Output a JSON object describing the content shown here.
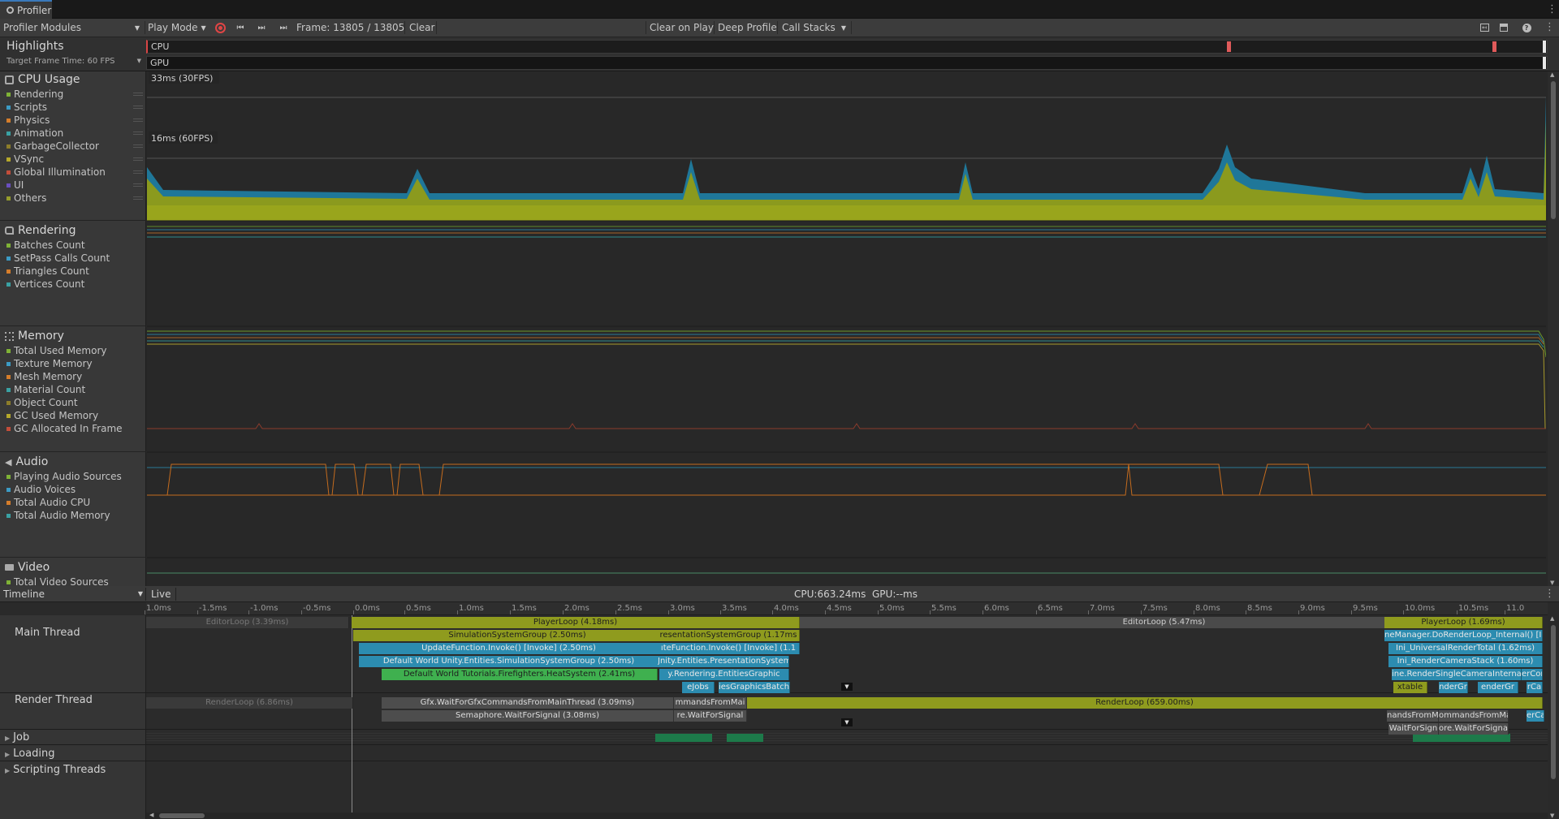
{
  "window": {
    "tab_title": "Profiler"
  },
  "toolbar": {
    "modules_label": "Profiler Modules",
    "play_mode_label": "Play Mode",
    "frame_label": "Frame: 13805 / 13805",
    "clear_label": "Clear",
    "clear_on_play_label": "Clear on Play",
    "deep_profile_label": "Deep Profile",
    "call_stacks_label": "Call Stacks"
  },
  "highlights": {
    "title": "Highlights",
    "target_label": "Target Frame Time: 60 FPS",
    "cpu_label": "CPU",
    "gpu_label": "GPU"
  },
  "modules": [
    {
      "name": "CPU Usage",
      "icon": "cpu-icon",
      "series": [
        {
          "label": "Rendering",
          "color": "#7fb236"
        },
        {
          "label": "Scripts",
          "color": "#3c9bc4"
        },
        {
          "label": "Physics",
          "color": "#d57d2b"
        },
        {
          "label": "Animation",
          "color": "#3aa1a3"
        },
        {
          "label": "GarbageCollector",
          "color": "#8c7d2a"
        },
        {
          "label": "VSync",
          "color": "#b5a82b"
        },
        {
          "label": "Global Illumination",
          "color": "#c24d3a"
        },
        {
          "label": "UI",
          "color": "#6a4fbf"
        },
        {
          "label": "Others",
          "color": "#959c2c"
        }
      ]
    },
    {
      "name": "Rendering",
      "icon": "rendering-icon",
      "series": [
        {
          "label": "Batches Count",
          "color": "#7fb236"
        },
        {
          "label": "SetPass Calls Count",
          "color": "#3c9bc4"
        },
        {
          "label": "Triangles Count",
          "color": "#d57d2b"
        },
        {
          "label": "Vertices Count",
          "color": "#3aa1a3"
        }
      ]
    },
    {
      "name": "Memory",
      "icon": "memory-icon",
      "series": [
        {
          "label": "Total Used Memory",
          "color": "#7fb236"
        },
        {
          "label": "Texture Memory",
          "color": "#3c9bc4"
        },
        {
          "label": "Mesh Memory",
          "color": "#d57d2b"
        },
        {
          "label": "Material Count",
          "color": "#3aa1a3"
        },
        {
          "label": "Object Count",
          "color": "#8c7d2a"
        },
        {
          "label": "GC Used Memory",
          "color": "#b5a82b"
        },
        {
          "label": "GC Allocated In Frame",
          "color": "#c24d3a"
        }
      ]
    },
    {
      "name": "Audio",
      "icon": "audio-icon",
      "series": [
        {
          "label": "Playing Audio Sources",
          "color": "#7fb236"
        },
        {
          "label": "Audio Voices",
          "color": "#3c9bc4"
        },
        {
          "label": "Total Audio CPU",
          "color": "#d57d2b"
        },
        {
          "label": "Total Audio Memory",
          "color": "#3aa1a3"
        }
      ]
    },
    {
      "name": "Video",
      "icon": "video-icon",
      "series": [
        {
          "label": "Total Video Sources",
          "color": "#7fb236"
        }
      ]
    }
  ],
  "cpu_chart": {
    "label_33": "33ms (30FPS)",
    "label_16": "16ms (60FPS)"
  },
  "details": {
    "view_label": "Timeline",
    "live_label": "Live",
    "cpu_gpu_label": "CPU:663.24ms  GPU:--ms",
    "ruler_ticks": [
      "1.0ms",
      "-1.5ms",
      "-1.0ms",
      "-0.5ms",
      "0.0ms",
      "0.5ms",
      "1.0ms",
      "1.5ms",
      "2.0ms",
      "2.5ms",
      "3.0ms",
      "3.5ms",
      "4.0ms",
      "4.5ms",
      "5.0ms",
      "5.5ms",
      "6.0ms",
      "6.5ms",
      "7.0ms",
      "7.5ms",
      "8.0ms",
      "8.5ms",
      "9.0ms",
      "9.5ms",
      "10.0ms",
      "10.5ms",
      "11.0"
    ],
    "threads": [
      "Main Thread",
      "Render Thread"
    ],
    "groups": [
      "Job",
      "Loading",
      "Scripting Threads"
    ],
    "main_bars": [
      {
        "text": "EditorLoop (3.39ms)",
        "color": "#3a3a3a",
        "fg": "#777"
      },
      {
        "text": "PlayerLoop (4.18ms)",
        "color": "#8f9b1e",
        "fg": "#1e1e1e"
      },
      {
        "text": "EditorLoop (5.47ms)",
        "color": "#4a4a4a",
        "fg": "#cfcfcf"
      },
      {
        "text": "PlayerLoop (1.69ms)",
        "color": "#8f9b1e",
        "fg": "#1e1e1e"
      },
      {
        "text": "SimulationSystemGroup (2.50ms)",
        "color": "#8f9b1e",
        "fg": "#1e1e1e"
      },
      {
        "text": "resentationSystemGroup (1.17ms",
        "color": "#8f9b1e",
        "fg": "#1e1e1e"
      },
      {
        "text": "UpdateFunction.Invoke() [Invoke] (2.50ms)",
        "color": "#2c8cb0",
        "fg": "#e8e8e8"
      },
      {
        "text": "ıteFunction.Invoke() [Invoke] (1.1",
        "color": "#2c8cb0",
        "fg": "#e8e8e8"
      },
      {
        "text": "Default World Unity.Entities.SimulationSystemGroup (2.50ms)",
        "color": "#2c8cb0",
        "fg": "#e8e8e8"
      },
      {
        "text": "Jnity.Entities.PresentationSystem",
        "color": "#2c8cb0",
        "fg": "#e8e8e8"
      },
      {
        "text": "Default World Tutorials.Firefighters.HeatSystem (2.41ms)",
        "color": "#3fb04f",
        "fg": "#1e1e1e"
      },
      {
        "text": "y.Rendering.EntitiesGraphic",
        "color": "#2c8cb0",
        "fg": "#e8e8e8"
      },
      {
        "text": "eJobs",
        "color": "#2c8cb0",
        "fg": "#e8e8e8"
      },
      {
        "text": "iesGraphicsBatch",
        "color": "#2c8cb0",
        "fg": "#e8e8e8"
      },
      {
        "text": "neManager.DoRenderLoop_Internal() [Invo",
        "color": "#2c8cb0",
        "fg": "#e8e8e8"
      },
      {
        "text": "Ini_UniversalRenderTotal (1.62ms)",
        "color": "#2c8cb0",
        "fg": "#e8e8e8"
      },
      {
        "text": "Ini_RenderCameraStack (1.60ms)",
        "color": "#2c8cb0",
        "fg": "#e8e8e8"
      },
      {
        "text": "ine.RenderSingleCameraInternal",
        "color": "#2c8cb0",
        "fg": "#e8e8e8"
      },
      {
        "text": "erConte",
        "color": "#2c8cb0",
        "fg": "#e8e8e8"
      },
      {
        "text": "xtable",
        "color": "#8f9b1e",
        "fg": "#1e1e1e"
      },
      {
        "text": "nderGr",
        "color": "#2c8cb0",
        "fg": "#e8e8e8"
      },
      {
        "text": "enderGr",
        "color": "#2c8cb0",
        "fg": "#e8e8e8"
      },
      {
        "text": "rCa",
        "color": "#2c8cb0",
        "fg": "#e8e8e8"
      }
    ],
    "render_bars": [
      {
        "text": "RenderLoop (6.86ms)",
        "color": "#3a3a3a",
        "fg": "#777"
      },
      {
        "text": "Gfx.WaitForGfxCommandsFromMainThread (3.09ms)",
        "color": "#4d4d4d",
        "fg": "#dcdcdc"
      },
      {
        "text": "mmandsFromMai",
        "color": "#4d4d4d",
        "fg": "#dcdcdc"
      },
      {
        "text": "RenderLoop (659.00ms)",
        "color": "#8f9b1e",
        "fg": "#1e1e1e"
      },
      {
        "text": "Semaphore.WaitForSignal (3.08ms)",
        "color": "#4d4d4d",
        "fg": "#dcdcdc"
      },
      {
        "text": "re.WaitForSignal",
        "color": "#4d4d4d",
        "fg": "#dcdcdc"
      },
      {
        "text": "nandsFromM",
        "color": "#4d4d4d",
        "fg": "#dcdcdc"
      },
      {
        "text": "ommandsFromMai",
        "color": "#4d4d4d",
        "fg": "#dcdcdc"
      },
      {
        "text": "WaitForSign",
        "color": "#4d4d4d",
        "fg": "#dcdcdc"
      },
      {
        "text": "ore.WaitForSignal",
        "color": "#4d4d4d",
        "fg": "#dcdcdc"
      },
      {
        "text": "erCa",
        "color": "#2c8cb0",
        "fg": "#e8e8e8"
      }
    ]
  }
}
